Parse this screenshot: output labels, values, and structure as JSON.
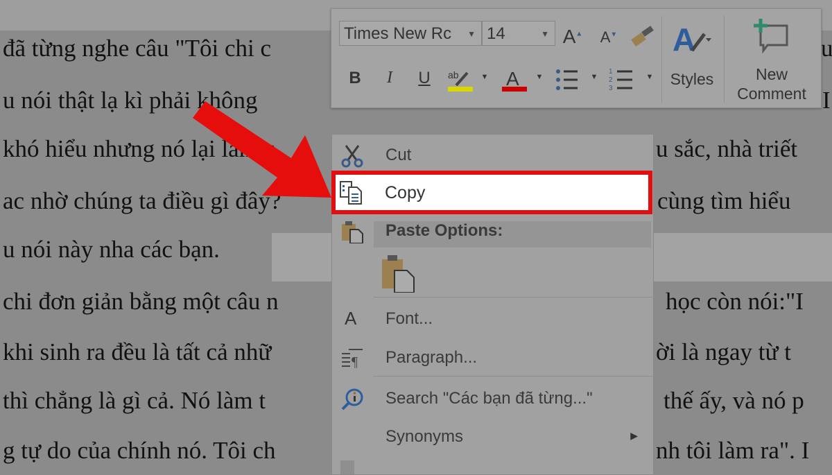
{
  "document": {
    "lines_left": [
      "đã từng nghe câu \"Tôi chi c",
      "u nói thật lạ kì phải không",
      "khó hiểu nhưng nó lại làm c",
      "ac nhờ chúng ta điều gì đây?",
      "u nói này nha các bạn.",
      "chi đơn giản bằng một câu n",
      "khi sinh ra đều là tất cả nhữ",
      "thì chẳng là gì cả. Nó làm t",
      "g tự do của chính nó. Tôi ch"
    ],
    "lines_right": [
      "u",
      "I",
      "u sắc, nhà triết",
      "cùng tìm hiểu",
      "",
      "học còn nói:\"I",
      "ời là ngay từ t",
      "thế ấy, và nó p",
      "nh tôi làm ra\". I"
    ]
  },
  "mini_toolbar": {
    "font_name": "Times New Rc",
    "font_size": "14",
    "bold": "B",
    "italic": "I",
    "underline": "U",
    "styles_label": "Styles",
    "new_comment_label_1": "New",
    "new_comment_label_2": "Comment",
    "highlight_color": "#d8d800",
    "font_color": "#cc0000"
  },
  "context_menu": {
    "items": [
      {
        "label": "Cut",
        "icon": "scissors-icon"
      },
      {
        "label": "Copy",
        "icon": "copy-icon"
      },
      {
        "label": "Paste Options:",
        "icon": "paste-icon"
      },
      {
        "label": "Font...",
        "icon": "font-icon"
      },
      {
        "label": "Paragraph...",
        "icon": "paragraph-icon"
      },
      {
        "label": "Search \"Các bạn đã từng...\"",
        "icon": "smart-lookup-icon"
      },
      {
        "label": "Synonyms",
        "icon": "submenu-arrow-icon"
      }
    ]
  },
  "annotation": {
    "arrow_color": "#e60d0d",
    "highlight_border_color": "#e10f0f"
  }
}
